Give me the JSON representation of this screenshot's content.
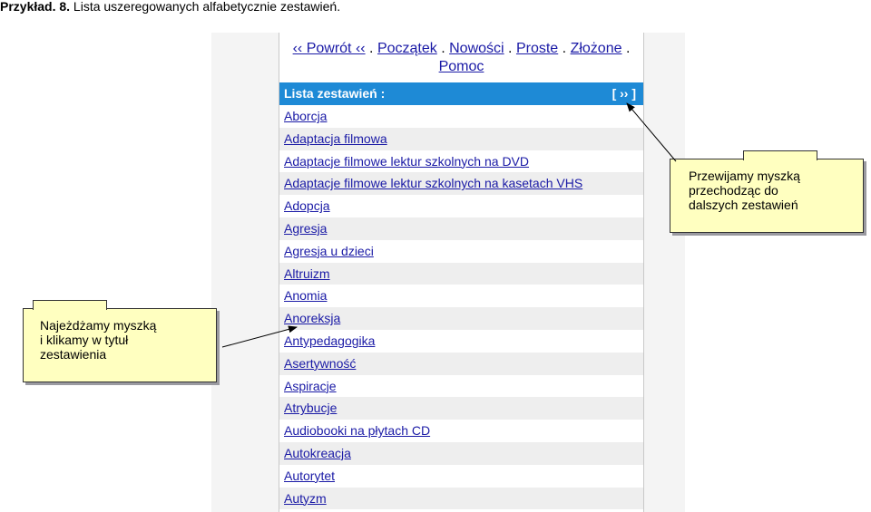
{
  "caption": {
    "bold": "Przykład. 8.",
    "text": " Lista uszeregowanych alfabetycznie zestawień."
  },
  "nav": {
    "back": "‹‹ Powrót ‹‹",
    "start": "Początek",
    "news": "Nowości",
    "simple": "Proste",
    "complex": "Złożone",
    "help": "Pomoc",
    "separator": "."
  },
  "list_header": {
    "title": "Lista zestawień :",
    "next": "[ ›› ]"
  },
  "items": [
    "Aborcja",
    "Adaptacja filmowa",
    "Adaptacje filmowe lektur szkolnych na DVD",
    "Adaptacje filmowe lektur szkolnych na kasetach VHS",
    "Adopcja",
    "Agresja",
    "Agresja u dzieci",
    "Altruizm",
    "Anomia",
    "Anoreksja",
    "Antypedagogika",
    "Asertywność",
    "Aspiracje",
    "Atrybucje",
    "Audiobooki na płytach CD",
    "Autokreacja",
    "Autorytet",
    "Autyzm"
  ],
  "notes": {
    "left": "Najeżdżamy myszką\ni klikamy w tytuł\nzestawienia",
    "right": "Przewijamy myszką\nprzechodząc do\ndalszych zestawień"
  },
  "colors": {
    "header_bg": "#1e8ad6",
    "link": "#1a1aa6",
    "note_bg": "#ffffc0"
  }
}
